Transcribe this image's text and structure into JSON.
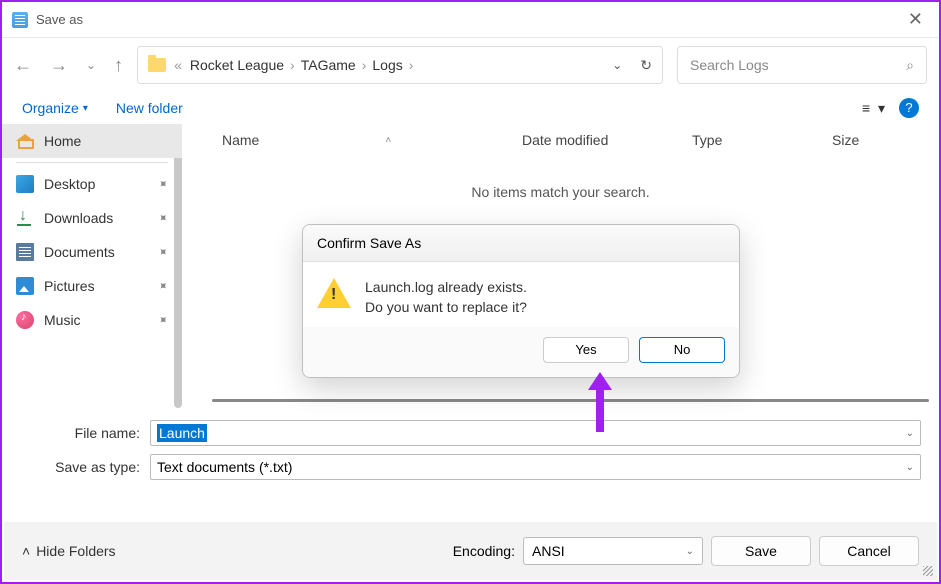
{
  "window": {
    "title": "Save as"
  },
  "nav": {
    "breadcrumbs": [
      "Rocket League",
      "TAGame",
      "Logs"
    ],
    "search_placeholder": "Search Logs"
  },
  "toolbar": {
    "organize": "Organize",
    "new_folder": "New folder"
  },
  "sidebar": {
    "items": [
      {
        "label": "Home",
        "icon": "home"
      },
      {
        "label": "Desktop",
        "icon": "desktop",
        "pinned": true
      },
      {
        "label": "Downloads",
        "icon": "download",
        "pinned": true
      },
      {
        "label": "Documents",
        "icon": "doc",
        "pinned": true
      },
      {
        "label": "Pictures",
        "icon": "pic",
        "pinned": true
      },
      {
        "label": "Music",
        "icon": "music",
        "pinned": true
      }
    ]
  },
  "columns": {
    "name": "Name",
    "date": "Date modified",
    "type": "Type",
    "size": "Size"
  },
  "empty_message": "No items match your search.",
  "form": {
    "filename_label": "File name:",
    "filename_value": "Launch",
    "type_label": "Save as type:",
    "type_value": "Text documents (*.txt)"
  },
  "footer": {
    "hide_folders": "Hide Folders",
    "encoding_label": "Encoding:",
    "encoding_value": "ANSI",
    "save": "Save",
    "cancel": "Cancel"
  },
  "modal": {
    "title": "Confirm Save As",
    "line1": "Launch.log already exists.",
    "line2": "Do you want to replace it?",
    "yes": "Yes",
    "no": "No"
  }
}
